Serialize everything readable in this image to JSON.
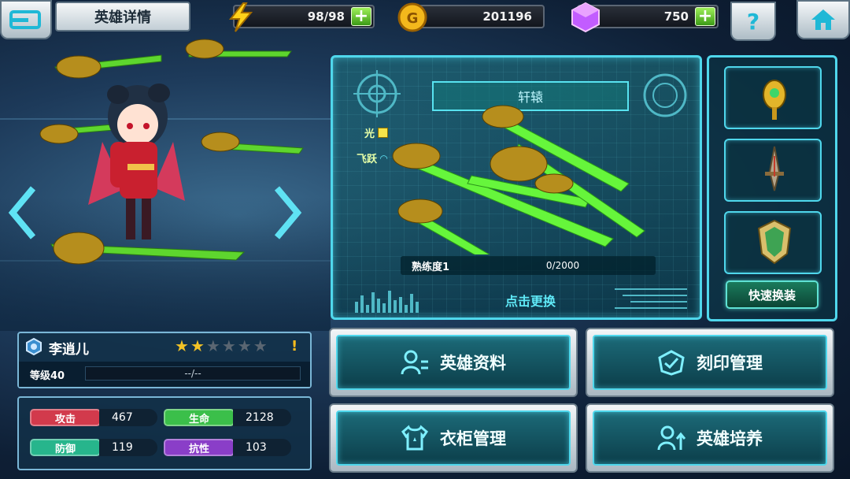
{
  "header": {
    "title": "英雄详情",
    "energy": "98/98",
    "gold": "201196",
    "gems": "750",
    "help_label": "?"
  },
  "hero": {
    "name": "李逍儿",
    "stars_filled": 2,
    "stars_total": 6,
    "warning": "!",
    "level_label": "等级40",
    "exp_text": "--/--"
  },
  "weapon": {
    "name": "轩辕",
    "tags": [
      "光",
      "飞跃"
    ],
    "proficiency_label": "熟练度1",
    "proficiency_value": "0/2000",
    "proficiency_fraction": 0,
    "change_label": "点击更换",
    "quick_swap_label": "快速换装"
  },
  "stats": [
    {
      "label": "攻击",
      "value": "467",
      "color": "#d23a4c"
    },
    {
      "label": "生命",
      "value": "2128",
      "color": "#3bbf4a"
    },
    {
      "label": "防御",
      "value": "119",
      "color": "#27b58c"
    },
    {
      "label": "抗性",
      "value": "103",
      "color": "#8a3ec8"
    }
  ],
  "menu": [
    {
      "label": "英雄资料",
      "icon": "hero-profile-icon"
    },
    {
      "label": "刻印管理",
      "icon": "imprint-icon"
    },
    {
      "label": "衣柜管理",
      "icon": "wardrobe-icon"
    },
    {
      "label": "英雄培养",
      "icon": "hero-training-icon"
    }
  ],
  "equipment_slots": [
    "golden-emblem-icon",
    "dagger-icon",
    "shield-badge-icon"
  ],
  "colors": {
    "accent": "#4fd7ec",
    "plus": "#5cc21f",
    "star": "#f3c326"
  }
}
